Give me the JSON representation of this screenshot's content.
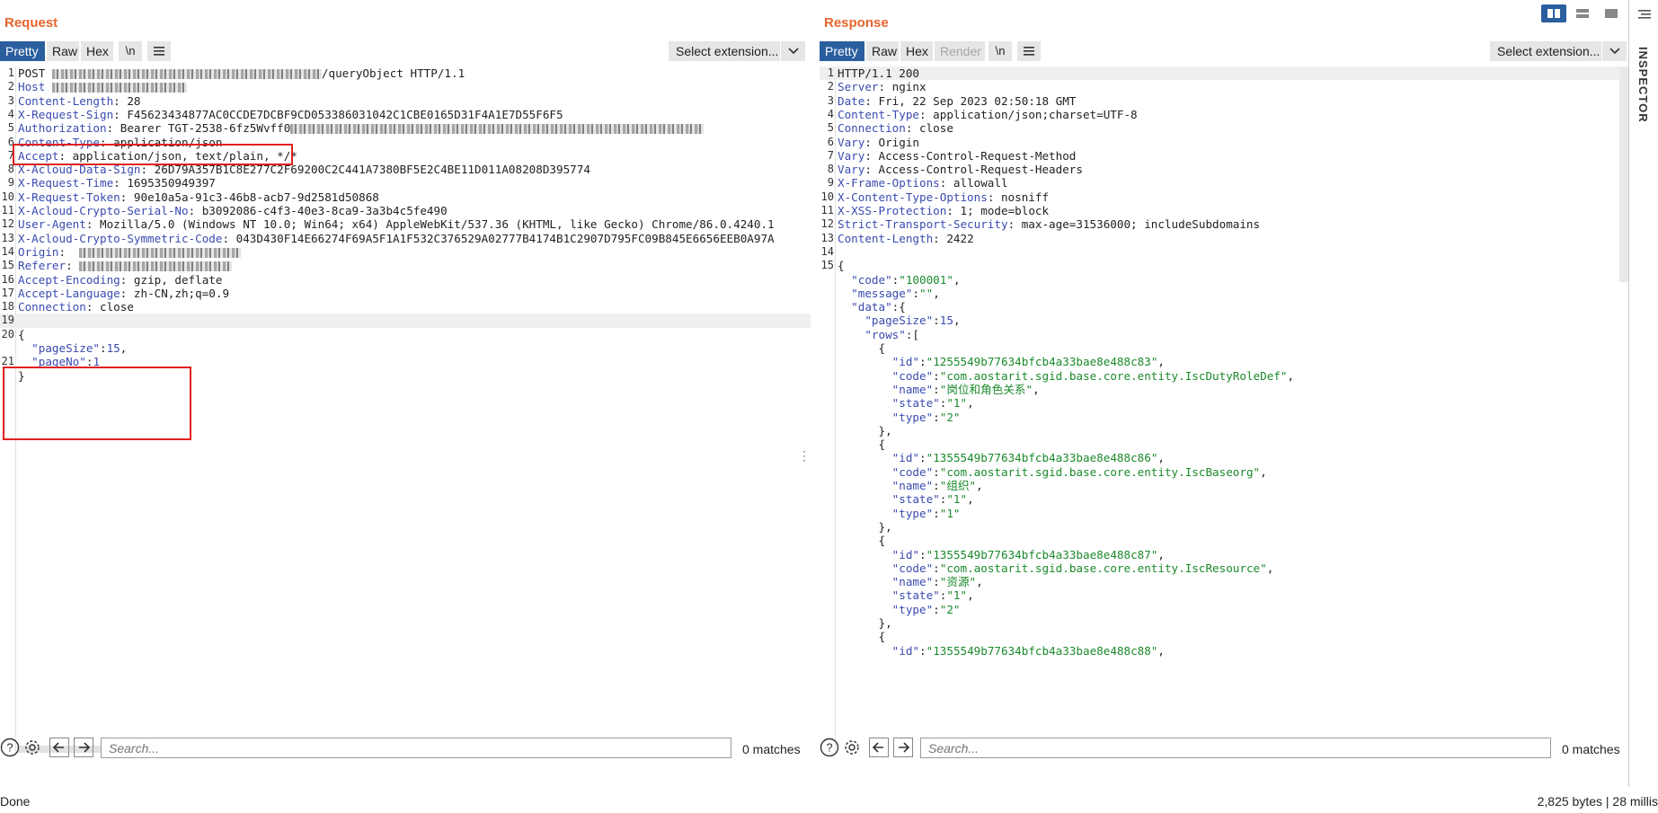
{
  "request": {
    "title": "Request",
    "tabs": [
      "Pretty",
      "Raw",
      "Hex"
    ],
    "newline_label": "\\n",
    "select_extension": "Select extension...",
    "lines": [
      {
        "n": "1",
        "segs": [
          {
            "t": "POST ",
            "c": "hv"
          },
          {
            "redact": 300
          },
          {
            "t": "/queryObject HTTP/1.1",
            "c": "hv"
          }
        ]
      },
      {
        "n": "2",
        "segs": [
          {
            "t": "Host",
            "c": "hn"
          },
          {
            "t": " ",
            "c": "hv"
          },
          {
            "redact": 150
          }
        ]
      },
      {
        "n": "3",
        "segs": [
          {
            "t": "Content-Length",
            "c": "hn"
          },
          {
            "t": ": 28",
            "c": "hv"
          }
        ]
      },
      {
        "n": "4",
        "segs": [
          {
            "t": "X-Request-Sign",
            "c": "hn"
          },
          {
            "t": ": F45623434877AC0CCDE7DCBF9CD053386031042C1CBE0165D31F4A1E7D55F6F5",
            "c": "hv"
          }
        ]
      },
      {
        "n": "5",
        "segs": [
          {
            "t": "Authorization",
            "c": "hn"
          },
          {
            "t": ": Bearer TGT-2538-6fz5Wvff0",
            "c": "hv"
          },
          {
            "redact": 460
          }
        ]
      },
      {
        "n": "6",
        "segs": [
          {
            "t": "Content-Type",
            "c": "hn"
          },
          {
            "t": ": application/json",
            "c": "hv"
          }
        ]
      },
      {
        "n": "7",
        "segs": [
          {
            "t": "Accept",
            "c": "hn"
          },
          {
            "t": ": application/json, text/plain, */*",
            "c": "hv"
          }
        ]
      },
      {
        "n": "8",
        "segs": [
          {
            "t": "X-Acloud-Data-Sign",
            "c": "hn"
          },
          {
            "t": ": 26D79A357B1C8E277C2F69200C2C441A7380BF5E2C4BE11D011A08208D395774",
            "c": "hv"
          }
        ]
      },
      {
        "n": "9",
        "segs": [
          {
            "t": "X-Request-Time",
            "c": "hn"
          },
          {
            "t": ": 1695350949397",
            "c": "hv"
          }
        ]
      },
      {
        "n": "10",
        "segs": [
          {
            "t": "X-Request-Token",
            "c": "hn"
          },
          {
            "t": ": 90e10a5a-91c3-46b8-acb7-9d2581d50868",
            "c": "hv"
          }
        ]
      },
      {
        "n": "11",
        "segs": [
          {
            "t": "X-Acloud-Crypto-Serial-No",
            "c": "hn"
          },
          {
            "t": ": b3092086-c4f3-40e3-8ca9-3a3b4c5fe490",
            "c": "hv"
          }
        ]
      },
      {
        "n": "12",
        "segs": [
          {
            "t": "User-Agent",
            "c": "hn"
          },
          {
            "t": ": Mozilla/5.0 (Windows NT 10.0; Win64; x64) AppleWebKit/537.36 (KHTML, like Gecko) Chrome/86.0.4240.1",
            "c": "hv"
          }
        ]
      },
      {
        "n": "13",
        "segs": [
          {
            "t": "X-Acloud-Crypto-Symmetric-Code",
            "c": "hn"
          },
          {
            "t": ": 043D430F14E66274F69A5F1A1F532C376529A02777B4174B1C2907D795FC09B845E6656EEB0A97A",
            "c": "hv"
          }
        ]
      },
      {
        "n": "14",
        "segs": [
          {
            "t": "Origin",
            "c": "hn"
          },
          {
            "t": ":  ",
            "c": "hv"
          },
          {
            "redact": 180
          }
        ]
      },
      {
        "n": "15",
        "segs": [
          {
            "t": "Referer",
            "c": "hn"
          },
          {
            "t": ": ",
            "c": "hv"
          },
          {
            "redact": 170
          }
        ]
      },
      {
        "n": "16",
        "segs": [
          {
            "t": "Accept-Encoding",
            "c": "hn"
          },
          {
            "t": ": gzip, deflate",
            "c": "hv"
          }
        ]
      },
      {
        "n": "17",
        "segs": [
          {
            "t": "Accept-Language",
            "c": "hn"
          },
          {
            "t": ": zh-CN,zh;q=0.9",
            "c": "hv"
          }
        ]
      },
      {
        "n": "18",
        "segs": [
          {
            "t": "Connection",
            "c": "hn"
          },
          {
            "t": ": close",
            "c": "hv"
          }
        ]
      },
      {
        "n": "19",
        "hl": true,
        "segs": []
      },
      {
        "n": "20",
        "segs": [
          {
            "t": "{",
            "c": "hv"
          }
        ]
      },
      {
        "n": "",
        "segs": [
          {
            "t": "  ",
            "c": "hv"
          },
          {
            "t": "\"pageSize\"",
            "c": "js-k"
          },
          {
            "t": ":",
            "c": "hv"
          },
          {
            "t": "15",
            "c": "js-k"
          },
          {
            "t": ",",
            "c": "hv"
          }
        ]
      },
      {
        "n": "21",
        "segs": [
          {
            "t": "  ",
            "c": "hv"
          },
          {
            "t": "\"pageNo\"",
            "c": "js-k"
          },
          {
            "t": ":",
            "c": "hv"
          },
          {
            "t": "1",
            "c": "js-k"
          }
        ]
      },
      {
        "n": "",
        "segs": [
          {
            "t": "}",
            "c": "hv"
          }
        ]
      }
    ],
    "matches": "0 matches",
    "search_placeholder": "Search..."
  },
  "response": {
    "title": "Response",
    "tabs": [
      "Pretty",
      "Raw",
      "Hex",
      "Render"
    ],
    "newline_label": "\\n",
    "select_extension": "Select extension...",
    "lines": [
      {
        "n": "1",
        "hl": true,
        "segs": [
          {
            "t": "HTTP/1.1 200",
            "c": "hv"
          }
        ]
      },
      {
        "n": "2",
        "segs": [
          {
            "t": "Server",
            "c": "hn"
          },
          {
            "t": ": nginx",
            "c": "hv"
          }
        ]
      },
      {
        "n": "3",
        "segs": [
          {
            "t": "Date",
            "c": "hn"
          },
          {
            "t": ": Fri, 22 Sep 2023 02:50:18 GMT",
            "c": "hv"
          }
        ]
      },
      {
        "n": "4",
        "segs": [
          {
            "t": "Content-Type",
            "c": "hn"
          },
          {
            "t": ": application/json;charset=UTF-8",
            "c": "hv"
          }
        ]
      },
      {
        "n": "5",
        "segs": [
          {
            "t": "Connection",
            "c": "hn"
          },
          {
            "t": ": close",
            "c": "hv"
          }
        ]
      },
      {
        "n": "6",
        "segs": [
          {
            "t": "Vary",
            "c": "hn"
          },
          {
            "t": ": Origin",
            "c": "hv"
          }
        ]
      },
      {
        "n": "7",
        "segs": [
          {
            "t": "Vary",
            "c": "hn"
          },
          {
            "t": ": Access-Control-Request-Method",
            "c": "hv"
          }
        ]
      },
      {
        "n": "8",
        "segs": [
          {
            "t": "Vary",
            "c": "hn"
          },
          {
            "t": ": Access-Control-Request-Headers",
            "c": "hv"
          }
        ]
      },
      {
        "n": "9",
        "segs": [
          {
            "t": "X-Frame-Options",
            "c": "hn"
          },
          {
            "t": ": allowall",
            "c": "hv"
          }
        ]
      },
      {
        "n": "10",
        "segs": [
          {
            "t": "X-Content-Type-Options",
            "c": "hn"
          },
          {
            "t": ": nosniff",
            "c": "hv"
          }
        ]
      },
      {
        "n": "11",
        "segs": [
          {
            "t": "X-XSS-Protection",
            "c": "hn"
          },
          {
            "t": ": 1; mode=block",
            "c": "hv"
          }
        ]
      },
      {
        "n": "12",
        "segs": [
          {
            "t": "Strict-Transport-Security",
            "c": "hn"
          },
          {
            "t": ": max-age=31536000; includeSubdomains",
            "c": "hv"
          }
        ]
      },
      {
        "n": "13",
        "segs": [
          {
            "t": "Content-Length",
            "c": "hn"
          },
          {
            "t": ": 2422",
            "c": "hv"
          }
        ]
      },
      {
        "n": "14",
        "segs": []
      },
      {
        "n": "15",
        "segs": [
          {
            "t": "{",
            "c": "hv"
          }
        ]
      },
      {
        "n": "",
        "segs": [
          {
            "t": "  ",
            "c": "hv"
          },
          {
            "t": "\"code\"",
            "c": "js-k"
          },
          {
            "t": ":",
            "c": "hv"
          },
          {
            "t": "\"100001\"",
            "c": "js-s"
          },
          {
            "t": ",",
            "c": "hv"
          }
        ]
      },
      {
        "n": "",
        "segs": [
          {
            "t": "  ",
            "c": "hv"
          },
          {
            "t": "\"message\"",
            "c": "js-k"
          },
          {
            "t": ":",
            "c": "hv"
          },
          {
            "t": "\"\"",
            "c": "js-s"
          },
          {
            "t": ",",
            "c": "hv"
          }
        ]
      },
      {
        "n": "",
        "segs": [
          {
            "t": "  ",
            "c": "hv"
          },
          {
            "t": "\"data\"",
            "c": "js-k"
          },
          {
            "t": ":{",
            "c": "hv"
          }
        ]
      },
      {
        "n": "",
        "segs": [
          {
            "t": "    ",
            "c": "hv"
          },
          {
            "t": "\"pageSize\"",
            "c": "js-k"
          },
          {
            "t": ":",
            "c": "hv"
          },
          {
            "t": "15",
            "c": "js-k"
          },
          {
            "t": ",",
            "c": "hv"
          }
        ]
      },
      {
        "n": "",
        "segs": [
          {
            "t": "    ",
            "c": "hv"
          },
          {
            "t": "\"rows\"",
            "c": "js-k"
          },
          {
            "t": ":[",
            "c": "hv"
          }
        ]
      },
      {
        "n": "",
        "segs": [
          {
            "t": "      {",
            "c": "hv"
          }
        ]
      },
      {
        "n": "",
        "segs": [
          {
            "t": "        ",
            "c": "hv"
          },
          {
            "t": "\"id\"",
            "c": "js-k"
          },
          {
            "t": ":",
            "c": "hv"
          },
          {
            "t": "\"1255549b77634bfcb4a33bae8e488c83\"",
            "c": "js-s"
          },
          {
            "t": ",",
            "c": "hv"
          }
        ]
      },
      {
        "n": "",
        "segs": [
          {
            "t": "        ",
            "c": "hv"
          },
          {
            "t": "\"code\"",
            "c": "js-k"
          },
          {
            "t": ":",
            "c": "hv"
          },
          {
            "t": "\"com.aostarit.sgid.base.core.entity.IscDutyRoleDef\"",
            "c": "js-s"
          },
          {
            "t": ",",
            "c": "hv"
          }
        ]
      },
      {
        "n": "",
        "segs": [
          {
            "t": "        ",
            "c": "hv"
          },
          {
            "t": "\"name\"",
            "c": "js-k"
          },
          {
            "t": ":",
            "c": "hv"
          },
          {
            "t": "\"岗位和角色关系\"",
            "c": "js-s"
          },
          {
            "t": ",",
            "c": "hv"
          }
        ]
      },
      {
        "n": "",
        "segs": [
          {
            "t": "        ",
            "c": "hv"
          },
          {
            "t": "\"state\"",
            "c": "js-k"
          },
          {
            "t": ":",
            "c": "hv"
          },
          {
            "t": "\"1\"",
            "c": "js-s"
          },
          {
            "t": ",",
            "c": "hv"
          }
        ]
      },
      {
        "n": "",
        "segs": [
          {
            "t": "        ",
            "c": "hv"
          },
          {
            "t": "\"type\"",
            "c": "js-k"
          },
          {
            "t": ":",
            "c": "hv"
          },
          {
            "t": "\"2\"",
            "c": "js-s"
          }
        ]
      },
      {
        "n": "",
        "segs": [
          {
            "t": "      },",
            "c": "hv"
          }
        ]
      },
      {
        "n": "",
        "segs": [
          {
            "t": "      {",
            "c": "hv"
          }
        ]
      },
      {
        "n": "",
        "segs": [
          {
            "t": "        ",
            "c": "hv"
          },
          {
            "t": "\"id\"",
            "c": "js-k"
          },
          {
            "t": ":",
            "c": "hv"
          },
          {
            "t": "\"1355549b77634bfcb4a33bae8e488c86\"",
            "c": "js-s"
          },
          {
            "t": ",",
            "c": "hv"
          }
        ]
      },
      {
        "n": "",
        "segs": [
          {
            "t": "        ",
            "c": "hv"
          },
          {
            "t": "\"code\"",
            "c": "js-k"
          },
          {
            "t": ":",
            "c": "hv"
          },
          {
            "t": "\"com.aostarit.sgid.base.core.entity.IscBaseorg\"",
            "c": "js-s"
          },
          {
            "t": ",",
            "c": "hv"
          }
        ]
      },
      {
        "n": "",
        "segs": [
          {
            "t": "        ",
            "c": "hv"
          },
          {
            "t": "\"name\"",
            "c": "js-k"
          },
          {
            "t": ":",
            "c": "hv"
          },
          {
            "t": "\"组织\"",
            "c": "js-s"
          },
          {
            "t": ",",
            "c": "hv"
          }
        ]
      },
      {
        "n": "",
        "segs": [
          {
            "t": "        ",
            "c": "hv"
          },
          {
            "t": "\"state\"",
            "c": "js-k"
          },
          {
            "t": ":",
            "c": "hv"
          },
          {
            "t": "\"1\"",
            "c": "js-s"
          },
          {
            "t": ",",
            "c": "hv"
          }
        ]
      },
      {
        "n": "",
        "segs": [
          {
            "t": "        ",
            "c": "hv"
          },
          {
            "t": "\"type\"",
            "c": "js-k"
          },
          {
            "t": ":",
            "c": "hv"
          },
          {
            "t": "\"1\"",
            "c": "js-s"
          }
        ]
      },
      {
        "n": "",
        "segs": [
          {
            "t": "      },",
            "c": "hv"
          }
        ]
      },
      {
        "n": "",
        "segs": [
          {
            "t": "      {",
            "c": "hv"
          }
        ]
      },
      {
        "n": "",
        "segs": [
          {
            "t": "        ",
            "c": "hv"
          },
          {
            "t": "\"id\"",
            "c": "js-k"
          },
          {
            "t": ":",
            "c": "hv"
          },
          {
            "t": "\"1355549b77634bfcb4a33bae8e488c87\"",
            "c": "js-s"
          },
          {
            "t": ",",
            "c": "hv"
          }
        ]
      },
      {
        "n": "",
        "segs": [
          {
            "t": "        ",
            "c": "hv"
          },
          {
            "t": "\"code\"",
            "c": "js-k"
          },
          {
            "t": ":",
            "c": "hv"
          },
          {
            "t": "\"com.aostarit.sgid.base.core.entity.IscResource\"",
            "c": "js-s"
          },
          {
            "t": ",",
            "c": "hv"
          }
        ]
      },
      {
        "n": "",
        "segs": [
          {
            "t": "        ",
            "c": "hv"
          },
          {
            "t": "\"name\"",
            "c": "js-k"
          },
          {
            "t": ":",
            "c": "hv"
          },
          {
            "t": "\"资源\"",
            "c": "js-s"
          },
          {
            "t": ",",
            "c": "hv"
          }
        ]
      },
      {
        "n": "",
        "segs": [
          {
            "t": "        ",
            "c": "hv"
          },
          {
            "t": "\"state\"",
            "c": "js-k"
          },
          {
            "t": ":",
            "c": "hv"
          },
          {
            "t": "\"1\"",
            "c": "js-s"
          },
          {
            "t": ",",
            "c": "hv"
          }
        ]
      },
      {
        "n": "",
        "segs": [
          {
            "t": "        ",
            "c": "hv"
          },
          {
            "t": "\"type\"",
            "c": "js-k"
          },
          {
            "t": ":",
            "c": "hv"
          },
          {
            "t": "\"2\"",
            "c": "js-s"
          }
        ]
      },
      {
        "n": "",
        "segs": [
          {
            "t": "      },",
            "c": "hv"
          }
        ]
      },
      {
        "n": "",
        "segs": [
          {
            "t": "      {",
            "c": "hv"
          }
        ]
      },
      {
        "n": "",
        "segs": [
          {
            "t": "        ",
            "c": "hv"
          },
          {
            "t": "\"id\"",
            "c": "js-k"
          },
          {
            "t": ":",
            "c": "hv"
          },
          {
            "t": "\"1355549b77634bfcb4a33bae8e488c88\"",
            "c": "js-s"
          },
          {
            "t": ",",
            "c": "hv"
          }
        ]
      }
    ],
    "matches": "0 matches",
    "search_placeholder": "Search..."
  },
  "inspector_label": "INSPECTOR",
  "status": {
    "left": "Done",
    "right": "2,825 bytes | 28 millis"
  },
  "colors": {
    "accent_orange": "#e8642c",
    "active_tab": "#2a5e9e",
    "header_name": "#3a4bb0",
    "json_string": "#1a8a2b",
    "red_box": "#e02020"
  }
}
